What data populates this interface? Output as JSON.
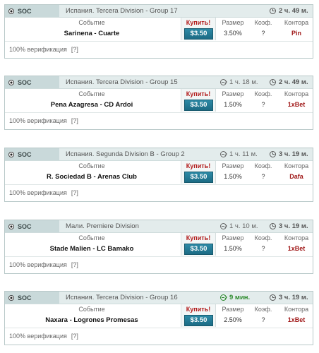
{
  "labels": {
    "sport": "SOC",
    "event_header": "Событие",
    "buy_header": "Купить!",
    "size_header": "Размер",
    "coef_header": "Коэф.",
    "book_header": "Контора",
    "verify": "100% верификация",
    "help": "[?]"
  },
  "colors": {
    "accent": "#1c6b84",
    "buy_red": "#b21a1a",
    "timer_green": "#2c8a2c"
  },
  "cards": [
    {
      "league": "Испания. Tercera Division - Group 17",
      "timer1": "",
      "timer2": "2 ч. 49 м.",
      "event": "Sarinena - Cuarte",
      "price": "$3.50",
      "size": "3.50%",
      "coef": "?",
      "bookmaker": "Pin"
    },
    {
      "league": "Испания. Tercera Division - Group 15",
      "timer1": "1 ч. 18 м.",
      "timer2": "2 ч. 49 м.",
      "event": "Pena Azagresa - CD Ardoi",
      "price": "$3.50",
      "size": "1.50%",
      "coef": "?",
      "bookmaker": "1xBet"
    },
    {
      "league": "Испания. Segunda Division B - Group 2",
      "timer1": "1 ч. 11 м.",
      "timer2": "3 ч. 19 м.",
      "event": "R. Sociedad B - Arenas Club",
      "price": "$3.50",
      "size": "1.50%",
      "coef": "?",
      "bookmaker": "Dafa"
    },
    {
      "league": "Мали. Premiere Division",
      "timer1": "1 ч. 10 м.",
      "timer2": "3 ч. 19 м.",
      "event": "Stade Malien - LC Bamako",
      "price": "$3.50",
      "size": "1.50%",
      "coef": "?",
      "bookmaker": "1xBet"
    },
    {
      "league": "Испания. Tercera Division - Group 16",
      "timer1": "9 мин.",
      "timer2": "3 ч. 19 м.",
      "event": "Naxara - Logrones Promesas",
      "price": "$3.50",
      "size": "2.50%",
      "coef": "?",
      "bookmaker": "1xBet"
    }
  ]
}
